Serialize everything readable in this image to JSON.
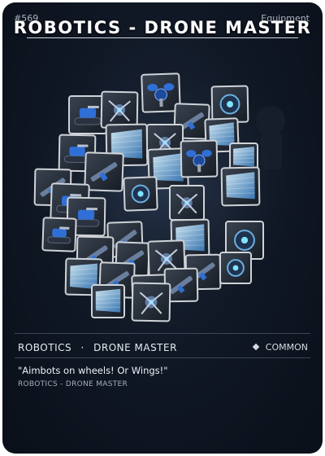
{
  "card": {
    "number": "#569",
    "category": "Equipment",
    "title": "ROBOTICS - DRONE MASTER",
    "info_category": "ROBOTICS",
    "info_separator": "·",
    "info_name": "DRONE MASTER",
    "rarity": "COMMON",
    "flavor_text": "\"Aimbots on wheels! Or Wings!\"",
    "subtitle": "ROBOTICS - DRONE MASTER"
  },
  "icons": {
    "rarity": "diamond-icon",
    "art_items": [
      "drone-icon",
      "tread-bot-icon",
      "shield-icon",
      "claw-bot-icon",
      "rifle-icon",
      "orb-bot-icon"
    ]
  },
  "colors": {
    "card_background": "#101825",
    "icon_frame": "#cfd3d8",
    "drone_blue": "#2f6fd6",
    "shield_cyan": "#8fd0f0",
    "accent_text": "#e6ebf1"
  }
}
